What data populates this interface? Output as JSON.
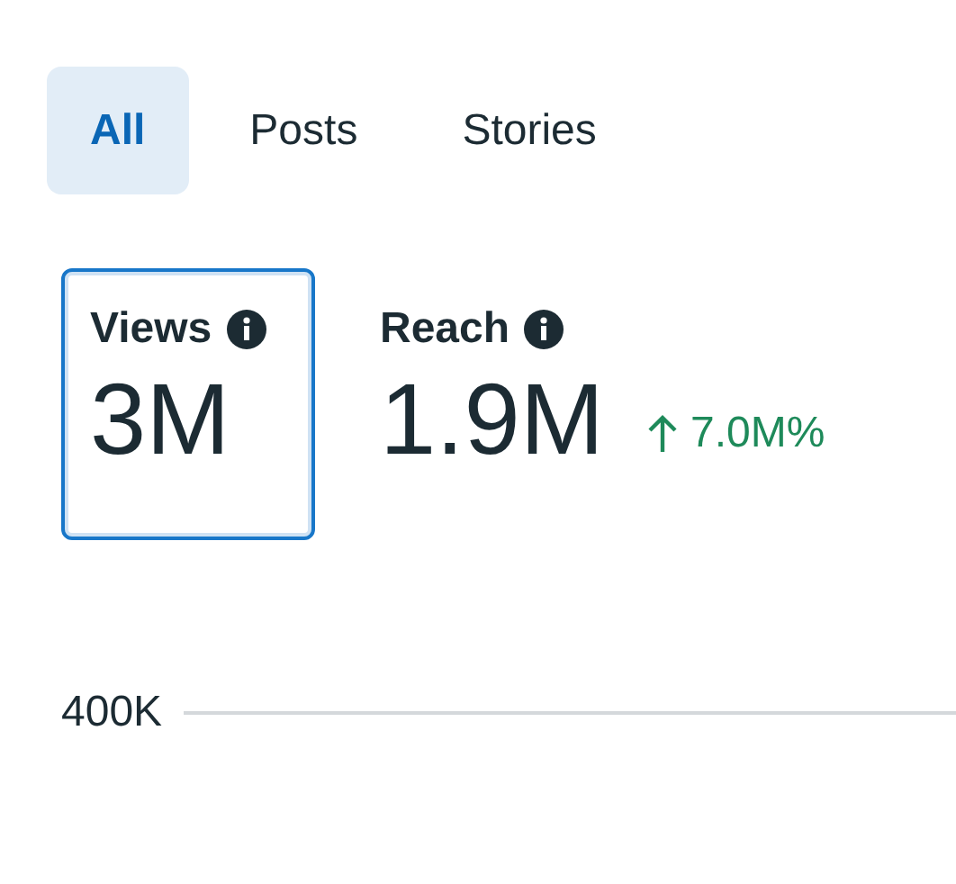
{
  "tabs": [
    {
      "label": "All",
      "selected": true
    },
    {
      "label": "Posts",
      "selected": false
    },
    {
      "label": "Stories",
      "selected": false
    }
  ],
  "metrics": [
    {
      "label": "Views",
      "value": "3M",
      "selected": true
    },
    {
      "label": "Reach",
      "value": "1.9M",
      "selected": false,
      "change": "7.0M%"
    }
  ],
  "chart": {
    "tick_label": "400K"
  }
}
